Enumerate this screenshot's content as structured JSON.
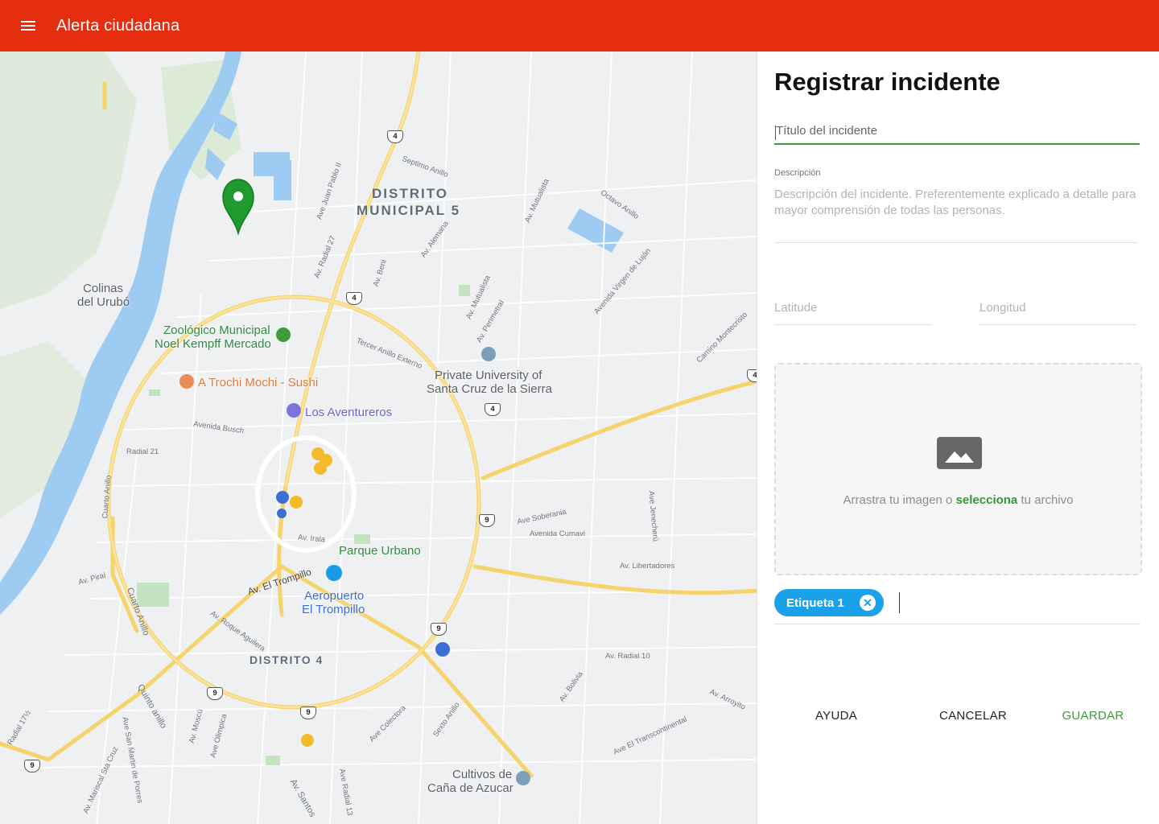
{
  "app": {
    "title": "Alerta ciudadana",
    "accent_color": "#E52D10"
  },
  "map": {
    "labels": {
      "distrito_5_line1": "DISTRITO",
      "distrito_5_line2": "MUNICIPAL 5",
      "colinas_line1": "Colinas",
      "colinas_line2": "del Urubó",
      "zoo_line1": "Zoológico Municipal",
      "zoo_line2": "Noel Kempff Mercado",
      "trochi": "A Trochi Mochi - Sushi",
      "aventureros": "Los Aventureros",
      "university_line1": "Private University of",
      "university_line2": "Santa Cruz de la Sierra",
      "parque": "Parque Urbano",
      "aeropuerto_line1": "Aeropuerto",
      "aeropuerto_line2": "El Trompillo",
      "distrito_4": "DISTRITO 4",
      "cultivos_line1": "Cultivos de",
      "cultivos_line2": "Caña de Azucar"
    },
    "streets": {
      "septimo": "Septimo Anillo",
      "juan_pablo": "Ave Juan Pablo II",
      "mutualista": "Av. Mutualista",
      "octavo": "Octavo Anillo",
      "radial27": "Av. Radial 27",
      "beni": "Av. Beni",
      "alemana": "Av. Alemana",
      "mutualista2": "Av. Mutualista",
      "perimetral": "Av. Perimetral",
      "virgen": "Avenida Virgen de Luján",
      "montecristo": "Camino Montecristo",
      "tercer": "Tercer Anillo Externo",
      "busch": "Avenida Busch",
      "radial21": "Radial 21",
      "cuarto": "Cuarto Anillo",
      "irala": "Av. Irala",
      "soberania": "Ave Soberania",
      "cumavi": "Avenida Cumavi",
      "jenecherú": "Ave Jenecherú",
      "libertadores": "Av. Libertadores",
      "pirai": "Av. Piraí",
      "trompillo": "Av. El Trompillo",
      "cuarto2": "Cuarto Anillo",
      "roque": "Av. Roque Aguilera",
      "radial10": "Av. Radial 10",
      "quinto": "Quinto anillo",
      "bolivia": "Av. Bolivia",
      "arroyito": "Av. Arroyito",
      "colectora": "Ave Colectora",
      "sexto": "Sexto Anillo",
      "transcontinental": "Ave El Transcontinental",
      "mosqu": "Av. Moscú",
      "olimpica": "Ave Olimpica",
      "radial17": "Radial 17½",
      "mariscal": "Av. Mariscal Sta Cruz",
      "sanmartin": "Ave San Martin de Porres",
      "santos": "Av. Santos",
      "radial13": "Ave Radial 13"
    },
    "shields": {
      "s4a": "4",
      "s4b": "4",
      "s4c": "4",
      "s4d": "4",
      "s9a": "9",
      "s9b": "9",
      "s9c": "9",
      "s9d": "9",
      "s9e": "9"
    },
    "marker_color": "#1f9a2e"
  },
  "panel": {
    "heading": "Registrar incidente",
    "title_placeholder": "Título del incidente",
    "description_label": "Descripción",
    "description_placeholder": "Descripción del incidente. Preferentemente explicado a detalle para mayor comprensión de todas las personas.",
    "latitude_placeholder": "Latitude",
    "longitude_placeholder": "Longitud",
    "dropzone": {
      "text_before": "Arrastra tu imagen o ",
      "link": "selecciona",
      "text_after": " tu archivo"
    },
    "tags": [
      {
        "label": "Etiqueta 1",
        "remove_glyph": "✕"
      }
    ],
    "buttons": {
      "help": "AYUDA",
      "cancel": "CANCELAR",
      "save": "GUARDAR"
    }
  }
}
